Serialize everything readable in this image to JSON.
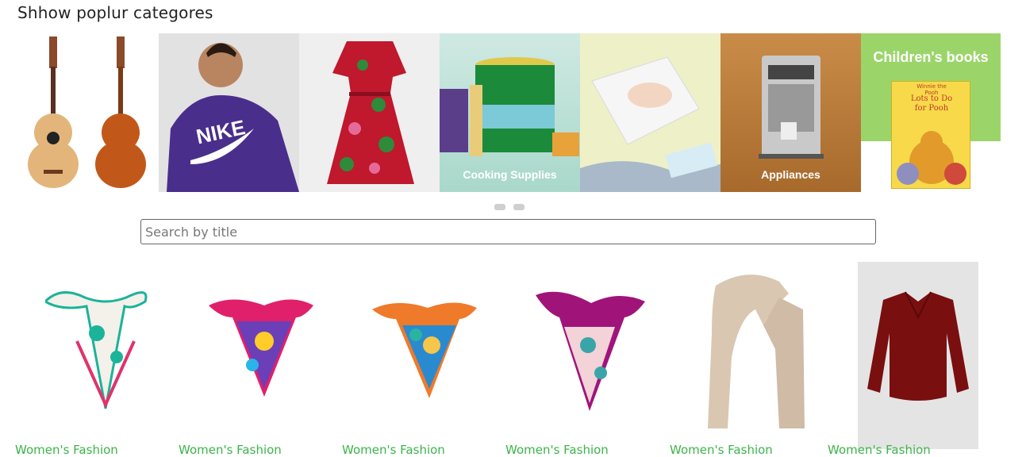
{
  "heading": "Shhow poplur categores",
  "carousel": {
    "tiles": [
      {
        "name": "guitars",
        "caption": ""
      },
      {
        "name": "men-fashion",
        "caption": ""
      },
      {
        "name": "dresses",
        "caption": ""
      },
      {
        "name": "cooking-supplies",
        "caption": "Cooking Supplies"
      },
      {
        "name": "baby-diapers",
        "caption": ""
      },
      {
        "name": "appliances",
        "caption": "Appliances"
      },
      {
        "name": "childrens-books",
        "caption": "Children's books"
      }
    ],
    "book_cover_text": "Lots to Do for Pooh",
    "book_brand": "Winnie the Pooh",
    "dots": 2
  },
  "search": {
    "placeholder": "Search by title",
    "value": ""
  },
  "products": [
    {
      "category": "Women's Fashion"
    },
    {
      "category": "Women's Fashion"
    },
    {
      "category": "Women's Fashion"
    },
    {
      "category": "Women's Fashion"
    },
    {
      "category": "Women's Fashion"
    },
    {
      "category": "Women's Fashion"
    }
  ],
  "colors": {
    "link": "#3cb44a",
    "nike_purple": "#4a2e8c",
    "appliances_bg": "#b9793a",
    "books_bg": "#9bd56a"
  }
}
